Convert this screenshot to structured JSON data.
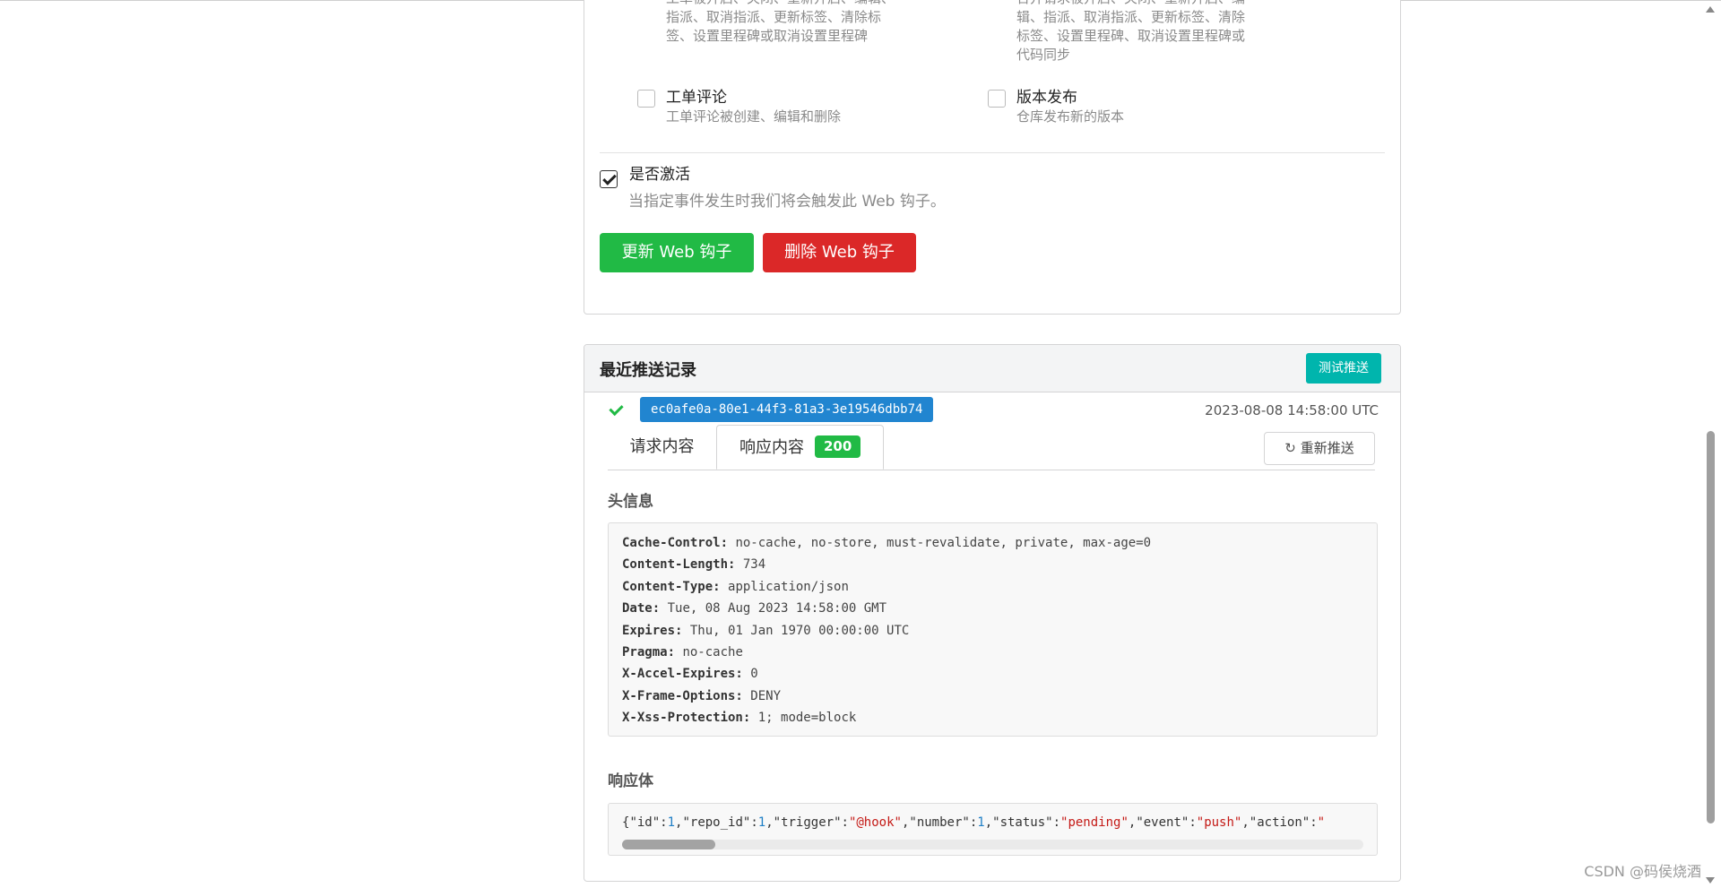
{
  "events": {
    "issue_top": {
      "desc": [
        "工单被开启、关闭、重新开启、编辑、",
        "指派、取消指派、更新标签、清除标",
        "签、设置里程碑或取消设置里程碑"
      ]
    },
    "pr_top": {
      "desc": [
        "合并请求被开启、关闭、重新开启、编",
        "辑、指派、取消指派、更新标签、清除",
        "标签、设置里程碑、取消设置里程碑或",
        "代码同步"
      ]
    },
    "issue_comment": {
      "title": "工单评论",
      "desc": "工单评论被创建、编辑和删除",
      "checked": false
    },
    "release": {
      "title": "版本发布",
      "desc": "仓库发布新的版本",
      "checked": false
    }
  },
  "active": {
    "label": "是否激活",
    "desc": "当指定事件发生时我们将会触发此 Web 钩子。",
    "checked": true
  },
  "buttons": {
    "update": "更新 Web 钩子",
    "delete": "删除 Web 钩子"
  },
  "history": {
    "title": "最近推送记录",
    "test_button": "测试推送",
    "delivery": {
      "uuid": "ec0afe0a-80e1-44f3-81a3-3e19546dbb74",
      "timestamp": "2023-08-08 14:58:00 UTC",
      "status": "success"
    },
    "tabs": {
      "request": "请求内容",
      "response": "响应内容",
      "status_code": "200"
    },
    "resend_button": "重新推送",
    "headers_title": "头信息",
    "headers": [
      {
        "key": "Cache-Control:",
        "value": "no-cache, no-store, must-revalidate, private, max-age=0"
      },
      {
        "key": "Content-Length:",
        "value": "734"
      },
      {
        "key": "Content-Type:",
        "value": "application/json"
      },
      {
        "key": "Date:",
        "value": "Tue, 08 Aug 2023 14:58:00 GMT"
      },
      {
        "key": "Expires:",
        "value": "Thu, 01 Jan 1970 00:00:00 UTC"
      },
      {
        "key": "Pragma:",
        "value": "no-cache"
      },
      {
        "key": "X-Accel-Expires:",
        "value": "0"
      },
      {
        "key": "X-Frame-Options:",
        "value": "DENY"
      },
      {
        "key": "X-Xss-Protection:",
        "value": "1; mode=block"
      }
    ],
    "body_title": "响应体",
    "body_tokens": [
      {
        "t": "{",
        "c": "j-k"
      },
      {
        "t": "\"id\"",
        "c": "j-k"
      },
      {
        "t": ":",
        "c": "j-k"
      },
      {
        "t": "1",
        "c": "j-n"
      },
      {
        "t": ",",
        "c": "j-k"
      },
      {
        "t": "\"repo_id\"",
        "c": "j-k"
      },
      {
        "t": ":",
        "c": "j-k"
      },
      {
        "t": "1",
        "c": "j-n"
      },
      {
        "t": ",",
        "c": "j-k"
      },
      {
        "t": "\"trigger\"",
        "c": "j-k"
      },
      {
        "t": ":",
        "c": "j-k"
      },
      {
        "t": "\"@hook\"",
        "c": "j-s"
      },
      {
        "t": ",",
        "c": "j-k"
      },
      {
        "t": "\"number\"",
        "c": "j-k"
      },
      {
        "t": ":",
        "c": "j-k"
      },
      {
        "t": "1",
        "c": "j-n"
      },
      {
        "t": ",",
        "c": "j-k"
      },
      {
        "t": "\"status\"",
        "c": "j-k"
      },
      {
        "t": ":",
        "c": "j-k"
      },
      {
        "t": "\"pending\"",
        "c": "j-s"
      },
      {
        "t": ",",
        "c": "j-k"
      },
      {
        "t": "\"event\"",
        "c": "j-k"
      },
      {
        "t": ":",
        "c": "j-k"
      },
      {
        "t": "\"push\"",
        "c": "j-s"
      },
      {
        "t": ",",
        "c": "j-k"
      },
      {
        "t": "\"action\"",
        "c": "j-k"
      },
      {
        "t": ":",
        "c": "j-k"
      },
      {
        "t": "\"",
        "c": "j-s"
      }
    ]
  },
  "watermark": "CSDN @码侯烧酒"
}
